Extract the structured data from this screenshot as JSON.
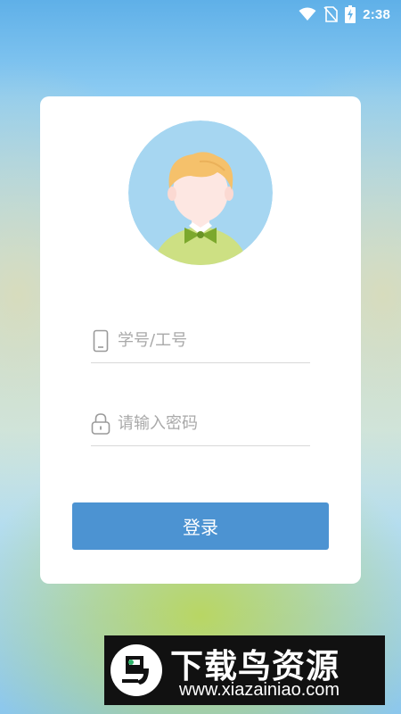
{
  "status_bar": {
    "time": "2:38",
    "icons": [
      "wifi-icon",
      "no-sim-icon",
      "battery-charging-icon"
    ]
  },
  "login": {
    "avatar_icon": "boy-avatar-icon",
    "username": {
      "icon": "phone-icon",
      "placeholder": "学号/工号",
      "value": ""
    },
    "password": {
      "icon": "lock-icon",
      "placeholder": "请输入密码",
      "value": ""
    },
    "submit_label": "登录",
    "button_color": "#4c93d2"
  },
  "watermark": {
    "logo_text": "鸟",
    "title": "下载鸟资源",
    "url": "www.xiazainiao.com"
  }
}
